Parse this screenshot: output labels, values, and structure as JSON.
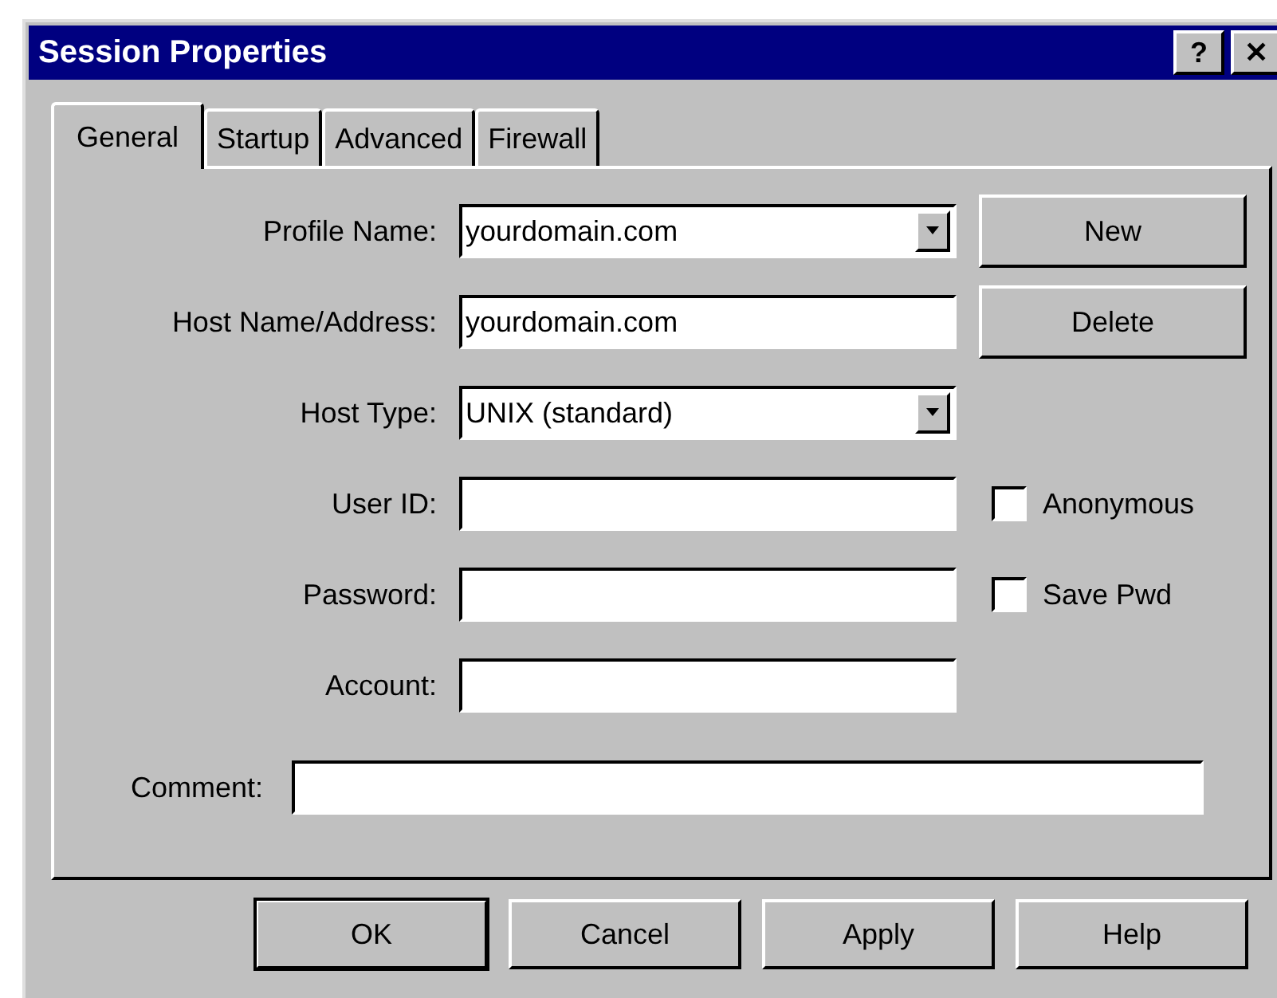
{
  "window": {
    "title": "Session Properties",
    "title_buttons": [
      "?",
      "✕"
    ]
  },
  "tabs": [
    {
      "label": "General",
      "selected": true
    },
    {
      "label": "Startup",
      "selected": false
    },
    {
      "label": "Advanced",
      "selected": false
    },
    {
      "label": "Firewall",
      "selected": false
    }
  ],
  "fields": [
    {
      "label": "Profile Name:",
      "kind": "combo",
      "value": "yourdomain.com"
    },
    {
      "label": "Host Name/Address:",
      "kind": "text",
      "value": "yourdomain.com"
    },
    {
      "label": "Host Type:",
      "kind": "combo",
      "value": "UNIX (standard)"
    },
    {
      "label": "User ID:",
      "kind": "text"
    },
    {
      "label": "Password:",
      "kind": "text"
    },
    {
      "label": "Account:",
      "kind": "text"
    }
  ],
  "side_buttons": [
    "New",
    "Delete"
  ],
  "checkboxes": [
    {
      "label": "Anonymous",
      "checked": false
    },
    {
      "label": "Save Pwd",
      "checked": false
    }
  ],
  "comment": {
    "label": "Comment:"
  },
  "buttons": [
    {
      "label": "OK",
      "default": true
    },
    {
      "label": "Cancel",
      "default": false
    },
    {
      "label": "Apply",
      "default": false
    },
    {
      "label": "Help",
      "default": false
    }
  ]
}
